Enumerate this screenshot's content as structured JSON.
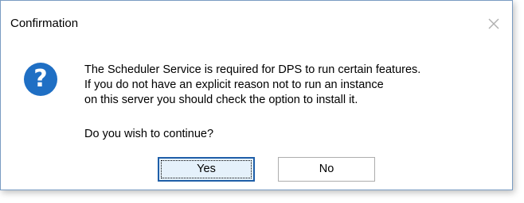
{
  "dialog": {
    "title": "Confirmation",
    "close_icon": "close-icon",
    "message_icon": "question-icon",
    "message_lines": [
      "The Scheduler Service is required for DPS to run certain features.",
      "If you do not have an explicit reason not to run an instance",
      "on this server you should check the option to install it."
    ],
    "question": "Do you wish to continue?",
    "buttons": {
      "yes_label": "Yes",
      "no_label": "No"
    },
    "colors": {
      "icon_blue": "#1f6fc4",
      "default_button_border": "#1e5ea8"
    }
  }
}
